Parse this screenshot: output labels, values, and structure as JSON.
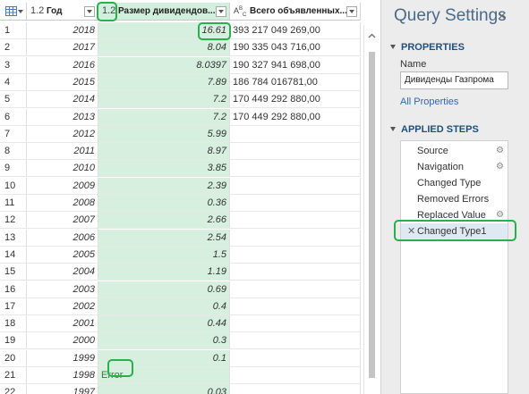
{
  "grid": {
    "columns": [
      {
        "type": "1.2",
        "name": "Год"
      },
      {
        "type": "1.2",
        "name": "Размер дивидендов..."
      },
      {
        "type": "ABC",
        "name": "Всего объявленных..."
      }
    ],
    "rows": [
      {
        "idx": "1",
        "year": "2018",
        "div": "16.61",
        "total": "393 217 049 269,00"
      },
      {
        "idx": "2",
        "year": "2017",
        "div": "8.04",
        "total": "190 335 043 716,00"
      },
      {
        "idx": "3",
        "year": "2016",
        "div": "8.0397",
        "total": "190 327 941 698,00"
      },
      {
        "idx": "4",
        "year": "2015",
        "div": "7.89",
        "total": "186 784 016781,00"
      },
      {
        "idx": "5",
        "year": "2014",
        "div": "7.2",
        "total": "170 449 292 880,00"
      },
      {
        "idx": "6",
        "year": "2013",
        "div": "7.2",
        "total": "170 449 292 880,00"
      },
      {
        "idx": "7",
        "year": "2012",
        "div": "5.99",
        "total": ""
      },
      {
        "idx": "8",
        "year": "2011",
        "div": "8.97",
        "total": ""
      },
      {
        "idx": "9",
        "year": "2010",
        "div": "3.85",
        "total": ""
      },
      {
        "idx": "10",
        "year": "2009",
        "div": "2.39",
        "total": ""
      },
      {
        "idx": "11",
        "year": "2008",
        "div": "0.36",
        "total": ""
      },
      {
        "idx": "12",
        "year": "2007",
        "div": "2.66",
        "total": ""
      },
      {
        "idx": "13",
        "year": "2006",
        "div": "2.54",
        "total": ""
      },
      {
        "idx": "14",
        "year": "2005",
        "div": "1.5",
        "total": ""
      },
      {
        "idx": "15",
        "year": "2004",
        "div": "1.19",
        "total": ""
      },
      {
        "idx": "16",
        "year": "2003",
        "div": "0.69",
        "total": ""
      },
      {
        "idx": "17",
        "year": "2002",
        "div": "0.4",
        "total": ""
      },
      {
        "idx": "18",
        "year": "2001",
        "div": "0.44",
        "total": ""
      },
      {
        "idx": "19",
        "year": "2000",
        "div": "0.3",
        "total": ""
      },
      {
        "idx": "20",
        "year": "1999",
        "div": "0.1",
        "total": ""
      },
      {
        "idx": "21",
        "year": "1998",
        "div": "",
        "err": "Error",
        "total": ""
      },
      {
        "idx": "22",
        "year": "1997",
        "div": "0.03",
        "total": ""
      }
    ]
  },
  "pane": {
    "title": "Query Settings",
    "close_icon": "×",
    "properties_header": "PROPERTIES",
    "name_label": "Name",
    "name_value": "Дивиденды Газпрома",
    "all_properties": "All Properties",
    "applied_steps_header": "APPLIED STEPS",
    "steps": [
      {
        "label": "Source",
        "gear": true
      },
      {
        "label": "Navigation",
        "gear": true
      },
      {
        "label": "Changed Type",
        "gear": false
      },
      {
        "label": "Removed Errors",
        "gear": false
      },
      {
        "label": "Replaced Value",
        "gear": true
      },
      {
        "label": "Changed Type1",
        "gear": false,
        "selected": true
      }
    ]
  },
  "colors": {
    "highlight_ring": "#27b04b",
    "selected_column": "#d6efdf",
    "title": "#4a6a8a",
    "section": "#1f4f7a",
    "link": "#2d68b0"
  }
}
